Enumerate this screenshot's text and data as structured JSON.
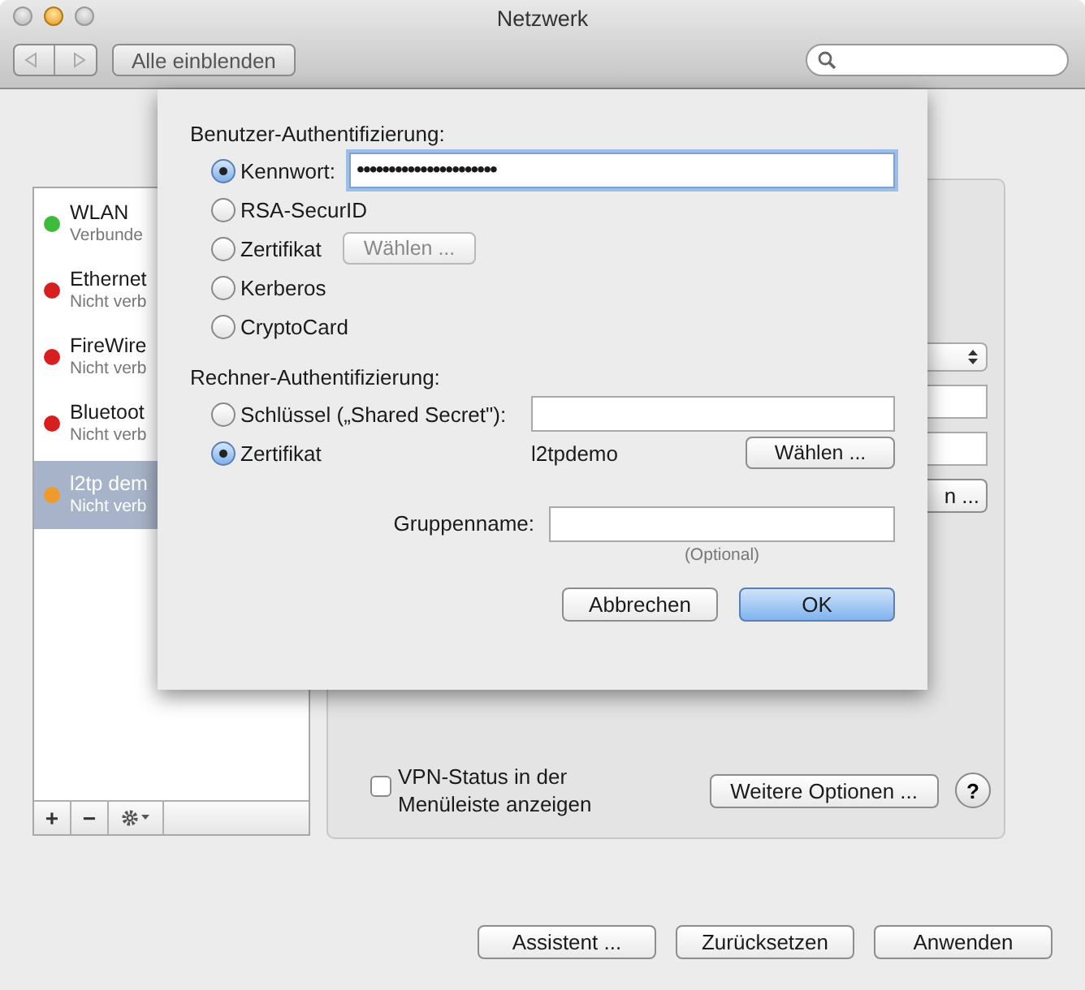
{
  "window": {
    "title": "Netzwerk"
  },
  "toolbar": {
    "show_all_button": "Alle einblenden"
  },
  "services": [
    {
      "name": "WLAN",
      "status": "Verbunde",
      "color": "#3dbb3d",
      "selected": false
    },
    {
      "name": "Ethernet",
      "status": "Nicht verb",
      "color": "#d81e1e",
      "selected": false
    },
    {
      "name": "FireWire",
      "status": "Nicht verb",
      "color": "#d81e1e",
      "selected": false
    },
    {
      "name": "Bluetoot",
      "status": "Nicht verb",
      "color": "#d81e1e",
      "selected": false
    },
    {
      "name": "l2tp dem",
      "status": "Nicht verb",
      "color": "#f09a2c",
      "selected": true
    }
  ],
  "sidebar_buttons": [
    "+",
    "−"
  ],
  "panel": {
    "peek_button": "n ...",
    "vpn_checkbox": {
      "label": "VPN-Status in der Menüleiste anzeigen",
      "checked": false
    },
    "more_options_button": "Weitere Optionen ...",
    "help_button": "?"
  },
  "sheet": {
    "user_auth": {
      "heading": "Benutzer-Authentifizierung:",
      "options": [
        {
          "kind": "password",
          "label": "Kennwort:",
          "selected": true,
          "value": "••••••••••••••••••••••"
        },
        {
          "kind": "plain",
          "label": "RSA-SecurID",
          "selected": false
        },
        {
          "kind": "button",
          "label": "Zertifikat",
          "selected": false,
          "button": "Wählen ...",
          "disabled": true
        },
        {
          "kind": "plain",
          "label": "Kerberos",
          "selected": false
        },
        {
          "kind": "plain",
          "label": "CryptoCard",
          "selected": false
        }
      ]
    },
    "machine_auth": {
      "heading": "Rechner-Authentifizierung:",
      "options": [
        {
          "kind": "field",
          "label": "Schlüssel („Shared Secret\"):",
          "selected": false
        },
        {
          "kind": "certificate",
          "label": "Zertifikat",
          "selected": true,
          "value": "l2tpdemo",
          "button": "Wählen ...",
          "disabled": false
        }
      ]
    },
    "group": {
      "label": "Gruppenname:",
      "hint": "(Optional)"
    },
    "buttons": [
      {
        "label": "Abbrechen",
        "default": false
      },
      {
        "label": "OK",
        "default": true
      }
    ]
  },
  "bottom_buttons": [
    "Assistent ...",
    "Zurücksetzen",
    "Anwenden"
  ]
}
